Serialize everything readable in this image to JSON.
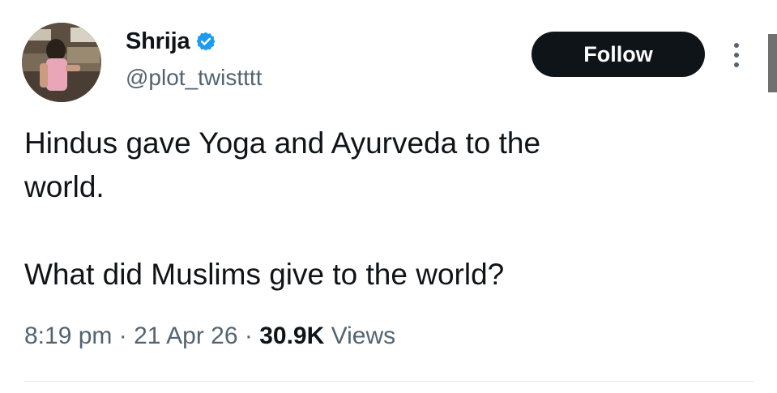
{
  "user": {
    "display_name": "Shrija",
    "handle": "@plot_twistttt",
    "verified": true,
    "verified_color": "#1d9bf0"
  },
  "follow_button": {
    "label": "Follow"
  },
  "tweet": {
    "text_lines": [
      "Hindus gave Yoga and Ayurveda to the",
      "world.",
      "What did Muslims give to the world?"
    ],
    "time": "8:19 pm",
    "date": "21 Apr 26",
    "views_count": "30.9K",
    "views_label": "Views",
    "separator": "·"
  },
  "icons": {
    "verified": "verified-badge-icon",
    "more": "more-vertical-icon"
  },
  "colors": {
    "text": "#0f1419",
    "secondary_text": "#536471",
    "button_bg": "#0f1419",
    "button_text": "#ffffff"
  }
}
